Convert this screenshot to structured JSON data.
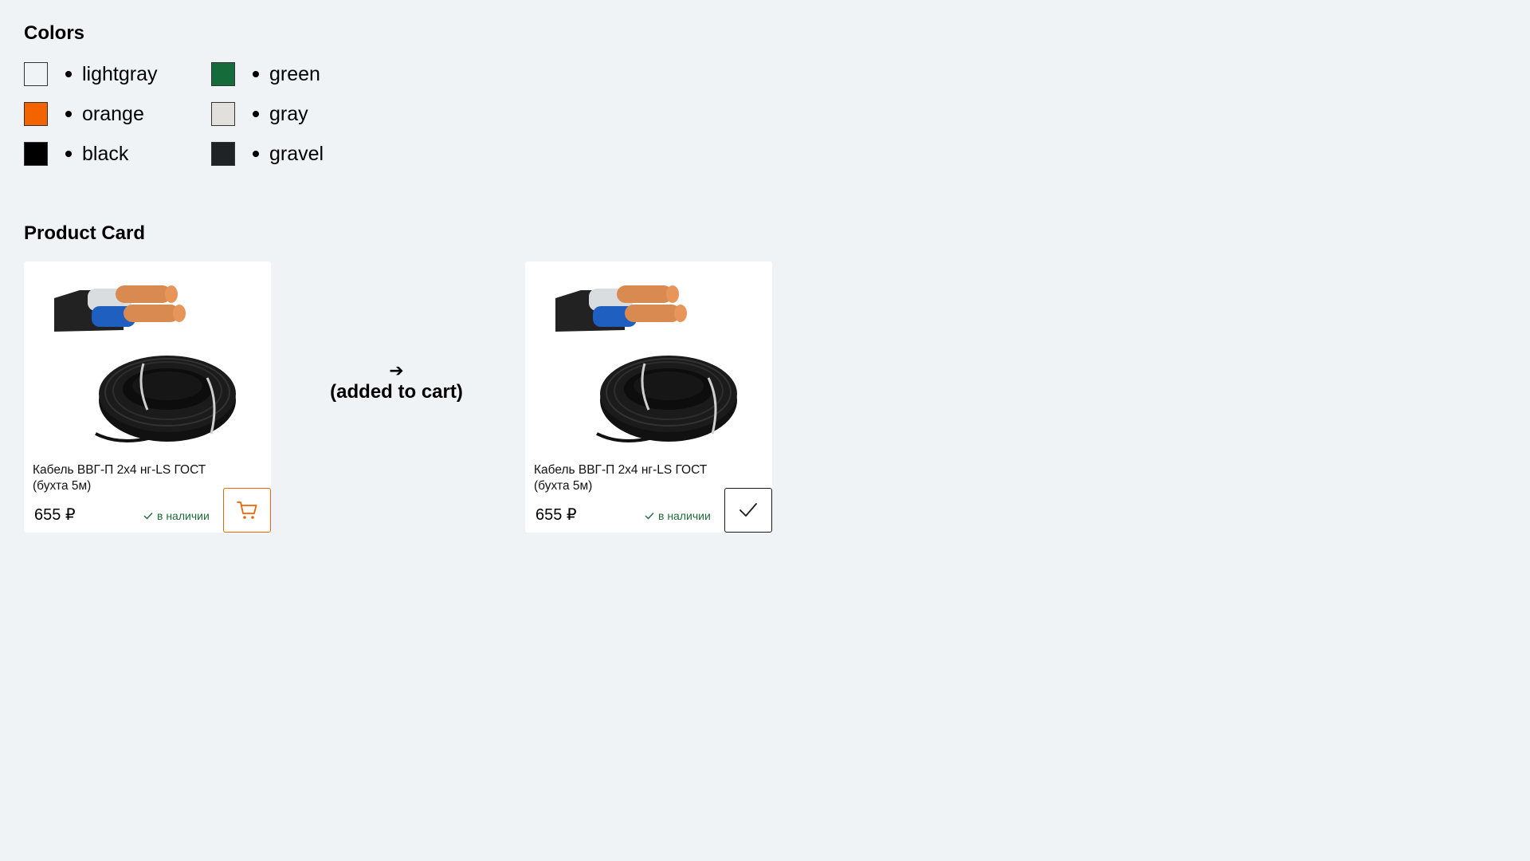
{
  "colors_section": {
    "title": "Colors",
    "swatches": [
      {
        "label": "lightgray",
        "hex": "#f0f3f6"
      },
      {
        "label": "orange",
        "hex": "#f36400"
      },
      {
        "label": "black",
        "hex": "#000000"
      },
      {
        "label": "green",
        "hex": "#156b3a"
      },
      {
        "label": "gray",
        "hex": "#e2e0dd"
      },
      {
        "label": "gravel",
        "hex": "#1f2326"
      }
    ]
  },
  "product_section": {
    "title": "Product Card",
    "transition_arrow": "➔",
    "transition_label": "(added to cart)",
    "cards": [
      {
        "name": "Кабель ВВГ-П 2х4 нг-LS ГОСТ (бухта 5м)",
        "price": "655 ₽",
        "stock": "в наличии",
        "button_icon": "cart-icon",
        "state": "default"
      },
      {
        "name": "Кабель ВВГ-П 2х4 нг-LS ГОСТ (бухта 5м)",
        "price": "655 ₽",
        "stock": "в наличии",
        "button_icon": "check-icon",
        "state": "added"
      }
    ]
  }
}
